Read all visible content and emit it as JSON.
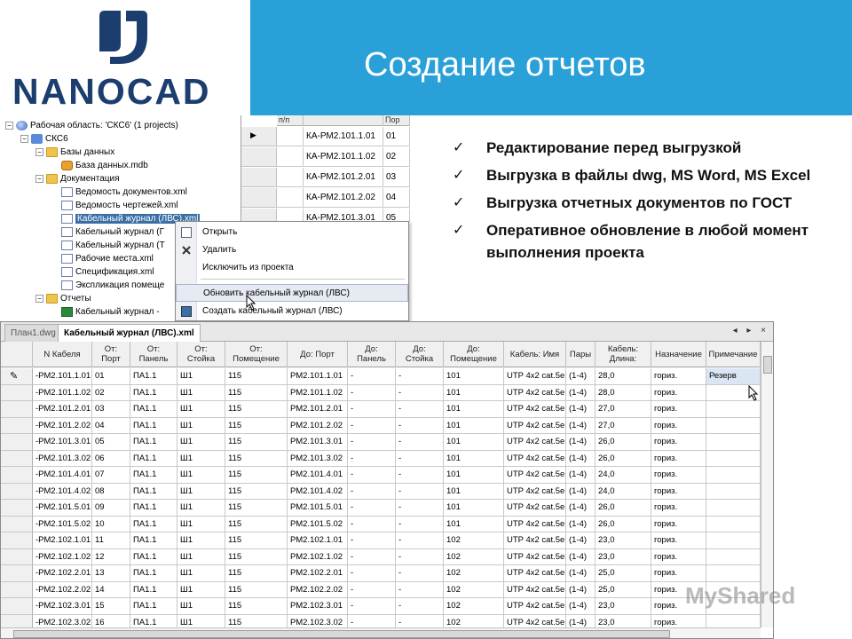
{
  "slide": {
    "title": "Создание отчетов"
  },
  "logo": {
    "text_dark": "NANO",
    "text_light": "CAD"
  },
  "tree": {
    "items": [
      {
        "label": "Рабочая область: 'СКС6' (1 projects)",
        "indent": 0,
        "icon": "workspace-icon",
        "exp": "−"
      },
      {
        "label": "СКС6",
        "indent": 1,
        "icon": "project-icon",
        "exp": "−"
      },
      {
        "label": "Базы данных",
        "indent": 2,
        "icon": "folder-icon",
        "exp": "−"
      },
      {
        "label": "База данных.mdb",
        "indent": 3,
        "icon": "database-icon",
        "exp": ""
      },
      {
        "label": "Документация",
        "indent": 2,
        "icon": "folder-icon",
        "exp": "−"
      },
      {
        "label": "Ведомость документов.xml",
        "indent": 3,
        "icon": "document-icon",
        "exp": ""
      },
      {
        "label": "Ведомость чертежей.xml",
        "indent": 3,
        "icon": "document-icon",
        "exp": ""
      },
      {
        "label": "Кабельный журнал (ЛВС).xml",
        "indent": 3,
        "icon": "document-icon",
        "exp": ""
      },
      {
        "label": "Кабельный журнал (Г",
        "indent": 3,
        "icon": "document-icon",
        "exp": ""
      },
      {
        "label": "Кабельный журнал (Т",
        "indent": 3,
        "icon": "document-icon",
        "exp": ""
      },
      {
        "label": "Рабочие места.xml",
        "indent": 3,
        "icon": "document-icon",
        "exp": ""
      },
      {
        "label": "Спецификация.xml",
        "indent": 3,
        "icon": "document-icon",
        "exp": ""
      },
      {
        "label": "Экспликация помеще",
        "indent": 3,
        "icon": "document-icon",
        "exp": ""
      },
      {
        "label": "Отчеты",
        "indent": 2,
        "icon": "folder-icon",
        "exp": "−"
      },
      {
        "label": "Кабельный журнал -",
        "indent": 3,
        "icon": "excel-icon",
        "exp": ""
      }
    ]
  },
  "top_grid": {
    "headers": [
      "п/п",
      "",
      "Пор"
    ],
    "rows": [
      {
        "name": "КА-РМ2.101.1.01",
        "port": "01"
      },
      {
        "name": "КА-РМ2.101.1.02",
        "port": "02"
      },
      {
        "name": "КА-РМ2.101.2.01",
        "port": "03"
      },
      {
        "name": "КА-РМ2.101.2.02",
        "port": "04"
      },
      {
        "name": "КА-РМ2.101.3.01",
        "port": "05"
      }
    ]
  },
  "context_menu": {
    "items": [
      {
        "label": "Открыть",
        "icon": "open-icon"
      },
      {
        "label": "Удалить",
        "icon": "delete-icon"
      },
      {
        "label": "Исключить из проекта",
        "icon": ""
      },
      {
        "label": "Обновить кабельный журнал (ЛВС)",
        "icon": ""
      },
      {
        "label": "Создать кабельный журнал (ЛВС)",
        "icon": "create-journal-icon"
      }
    ]
  },
  "bullets": [
    "Редактирование перед выгрузкой",
    "Выгрузка в файлы dwg, MS Word, MS Excel",
    "Выгрузка отчетных документов по ГОСТ",
    "Оперативное обновление в любой момент выполнения проекта"
  ],
  "tabs": [
    {
      "label": "План1.dwg",
      "active": false
    },
    {
      "label": "Кабельный журнал (ЛВС).xml",
      "active": true
    }
  ],
  "tab_nav": "◂ ▸ ×",
  "table": {
    "headers": [
      "N Кабеля",
      "От:\nПорт",
      "От:\nПанель",
      "От:\nСтойка",
      "От:\nПомещение",
      "До: Порт",
      "До:\nПанель",
      "До:\nСтойка",
      "До:\nПомещение",
      "Кабель: Имя",
      "Пары",
      "Кабель:\nДлина:",
      "Назначение",
      "Примечание"
    ],
    "rows": [
      [
        "-РМ2.101.1.01",
        "01",
        "ПА1.1",
        "Ш1",
        "115",
        "РМ2.101.1.01",
        "-",
        "-",
        "101",
        "UTP 4x2 cat.5e",
        "(1-4)",
        "28,0",
        "гориз.",
        "Резерв"
      ],
      [
        "-РМ2.101.1.02",
        "02",
        "ПА1.1",
        "Ш1",
        "115",
        "РМ2.101.1.02",
        "-",
        "-",
        "101",
        "UTP 4x2 cat.5e",
        "(1-4)",
        "28,0",
        "гориз.",
        ""
      ],
      [
        "-РМ2.101.2.01",
        "03",
        "ПА1.1",
        "Ш1",
        "115",
        "РМ2.101.2.01",
        "-",
        "-",
        "101",
        "UTP 4x2 cat.5e",
        "(1-4)",
        "27,0",
        "гориз.",
        ""
      ],
      [
        "-РМ2.101.2.02",
        "04",
        "ПА1.1",
        "Ш1",
        "115",
        "РМ2.101.2.02",
        "-",
        "-",
        "101",
        "UTP 4x2 cat.5e",
        "(1-4)",
        "27,0",
        "гориз.",
        ""
      ],
      [
        "-РМ2.101.3.01",
        "05",
        "ПА1.1",
        "Ш1",
        "115",
        "РМ2.101.3.01",
        "-",
        "-",
        "101",
        "UTP 4x2 cat.5e",
        "(1-4)",
        "26,0",
        "гориз.",
        ""
      ],
      [
        "-РМ2.101.3.02",
        "06",
        "ПА1.1",
        "Ш1",
        "115",
        "РМ2.101.3.02",
        "-",
        "-",
        "101",
        "UTP 4x2 cat.5e",
        "(1-4)",
        "26,0",
        "гориз.",
        ""
      ],
      [
        "-РМ2.101.4.01",
        "07",
        "ПА1.1",
        "Ш1",
        "115",
        "РМ2.101.4.01",
        "-",
        "-",
        "101",
        "UTP 4x2 cat.5e",
        "(1-4)",
        "24,0",
        "гориз.",
        ""
      ],
      [
        "-РМ2.101.4.02",
        "08",
        "ПА1.1",
        "Ш1",
        "115",
        "РМ2.101.4.02",
        "-",
        "-",
        "101",
        "UTP 4x2 cat.5e",
        "(1-4)",
        "24,0",
        "гориз.",
        ""
      ],
      [
        "-РМ2.101.5.01",
        "09",
        "ПА1.1",
        "Ш1",
        "115",
        "РМ2.101.5.01",
        "-",
        "-",
        "101",
        "UTP 4x2 cat.5e",
        "(1-4)",
        "26,0",
        "гориз.",
        ""
      ],
      [
        "-РМ2.101.5.02",
        "10",
        "ПА1.1",
        "Ш1",
        "115",
        "РМ2.101.5.02",
        "-",
        "-",
        "101",
        "UTP 4x2 cat.5e",
        "(1-4)",
        "26,0",
        "гориз.",
        ""
      ],
      [
        "-РМ2.102.1.01",
        "11",
        "ПА1.1",
        "Ш1",
        "115",
        "РМ2.102.1.01",
        "-",
        "-",
        "102",
        "UTP 4x2 cat.5e",
        "(1-4)",
        "23,0",
        "гориз.",
        ""
      ],
      [
        "-РМ2.102.1.02",
        "12",
        "ПА1.1",
        "Ш1",
        "115",
        "РМ2.102.1.02",
        "-",
        "-",
        "102",
        "UTP 4x2 cat.5e",
        "(1-4)",
        "23,0",
        "гориз.",
        ""
      ],
      [
        "-РМ2.102.2.01",
        "13",
        "ПА1.1",
        "Ш1",
        "115",
        "РМ2.102.2.01",
        "-",
        "-",
        "102",
        "UTP 4x2 cat.5e",
        "(1-4)",
        "25,0",
        "гориз.",
        ""
      ],
      [
        "-РМ2.102.2.02",
        "14",
        "ПА1.1",
        "Ш1",
        "115",
        "РМ2.102.2.02",
        "-",
        "-",
        "102",
        "UTP 4x2 cat.5e",
        "(1-4)",
        "25,0",
        "гориз.",
        ""
      ],
      [
        "-РМ2.102.3.01",
        "15",
        "ПА1.1",
        "Ш1",
        "115",
        "РМ2.102.3.01",
        "-",
        "-",
        "102",
        "UTP 4x2 cat.5e",
        "(1-4)",
        "23,0",
        "гориз.",
        ""
      ],
      [
        "-РМ2.102.3.02",
        "16",
        "ПА1.1",
        "Ш1",
        "115",
        "РМ2.102.3.02",
        "-",
        "-",
        "102",
        "UTP 4x2 cat.5e",
        "(1-4)",
        "23,0",
        "гориз.",
        ""
      ]
    ]
  },
  "watermark": "MyShared",
  "colors": {
    "header_bg": "#2aa0d8",
    "logo_dark": "#1b3e6e",
    "selection": "#3a6ea5"
  }
}
